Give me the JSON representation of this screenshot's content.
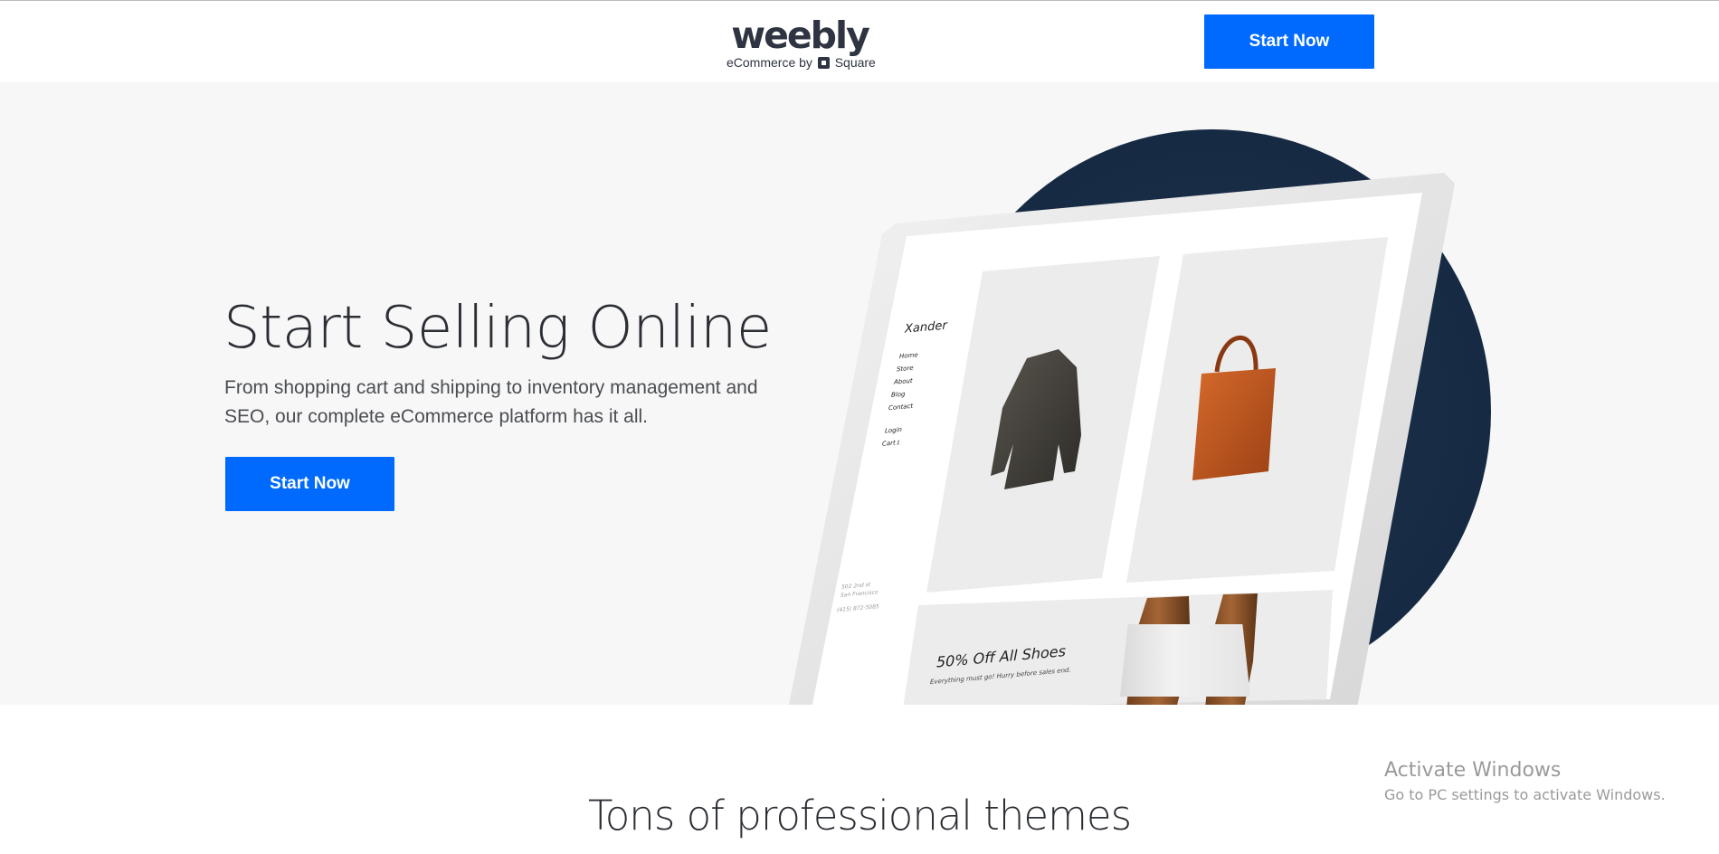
{
  "header": {
    "logo_word": "weebly",
    "logo_sub_left": "eCommerce by",
    "logo_sub_right": "Square",
    "cta_label": "Start Now"
  },
  "hero": {
    "title": "Start Selling Online",
    "description": "From shopping cart and shipping to inventory management and SEO, our complete eCommerce platform has it all.",
    "cta_label": "Start Now"
  },
  "mockup": {
    "site_name": "Xander",
    "nav": [
      "Home",
      "Store",
      "About",
      "Blog",
      "Contact"
    ],
    "login": "Login",
    "cart": "Cart",
    "cart_count": "1",
    "address_line1": "502 2nd st",
    "address_line2": "San Francisco",
    "phone": "(415) 872-5085",
    "promo_title": "50% Off All Shoes",
    "promo_sub": "Everything must go! Hurry before sales end."
  },
  "themes": {
    "title": "Tons of professional themes"
  },
  "os_overlay": {
    "title": "Activate Windows",
    "subtitle": "Go to PC settings to activate Windows."
  },
  "colors": {
    "brand_blue": "#006aff",
    "navy_circle": "#172a43",
    "hero_bg": "#f7f7f7"
  }
}
